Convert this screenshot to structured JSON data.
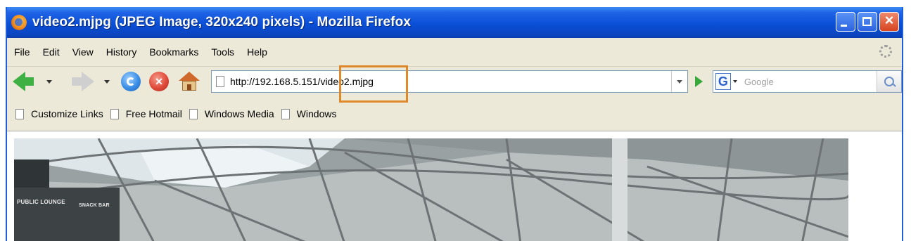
{
  "window": {
    "title": "video2.mjpg (JPEG Image, 320x240 pixels) - Mozilla Firefox",
    "app_icon": "firefox-icon",
    "controls": [
      "minimize",
      "maximize",
      "close"
    ]
  },
  "menubar": {
    "items": [
      {
        "label": "File"
      },
      {
        "label": "Edit"
      },
      {
        "label": "View"
      },
      {
        "label": "History"
      },
      {
        "label": "Bookmarks"
      },
      {
        "label": "Tools"
      },
      {
        "label": "Help"
      }
    ]
  },
  "navigation": {
    "url": "http://192.168.5.151/video2.mjpg",
    "search_engine_icon": "G",
    "search_placeholder": "Google"
  },
  "bookmarks": {
    "items": [
      {
        "label": "Customize Links"
      },
      {
        "label": "Free Hotmail"
      },
      {
        "label": "Windows Media"
      },
      {
        "label": "Windows"
      }
    ]
  },
  "image": {
    "signs": {
      "left": "PUBLIC LOUNGE",
      "right": "SNACK BAR"
    }
  },
  "colors": {
    "titlebar": "#0a4fd6",
    "highlight_box": "#e0892a",
    "chrome": "#ece9d8"
  }
}
